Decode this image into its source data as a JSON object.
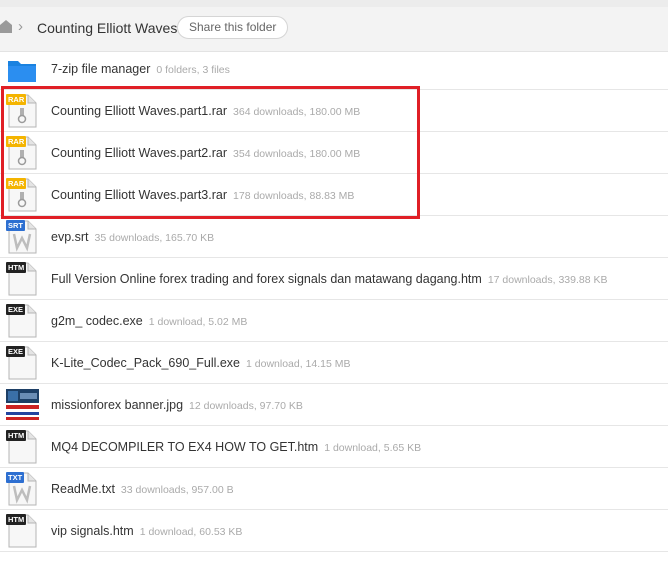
{
  "breadcrumb": {
    "separator": "›",
    "title": "Counting Elliott Waves"
  },
  "share_button": "Share this folder",
  "colors": {
    "highlight": "#e01f26",
    "folder": "#1a82e0",
    "rar_badge": "#f4b400",
    "srt_badge": "#2d6fd1",
    "txt_badge": "#2d6fd1",
    "dark_badge": "#222222"
  },
  "rows": [
    {
      "icon": "folder-icon",
      "name": "7-zip file manager",
      "meta": "0 folders, 3 files"
    },
    {
      "icon": "rar-file-icon",
      "badge": "RAR",
      "name": "Counting Elliott Waves.part1.rar",
      "meta": "364 downloads, 180.00 MB"
    },
    {
      "icon": "rar-file-icon",
      "badge": "RAR",
      "name": "Counting Elliott Waves.part2.rar",
      "meta": "354 downloads, 180.00 MB"
    },
    {
      "icon": "rar-file-icon",
      "badge": "RAR",
      "name": "Counting Elliott Waves.part3.rar",
      "meta": "178 downloads, 88.83 MB"
    },
    {
      "icon": "srt-file-icon",
      "badge": "SRT",
      "name": "evp.srt",
      "meta": "35 downloads, 165.70 KB"
    },
    {
      "icon": "htm-file-icon",
      "badge": "HTM",
      "name": "Full Version Online forex trading and forex signals dan matawang dagang.htm",
      "meta": "17 downloads, 339.88 KB"
    },
    {
      "icon": "exe-file-icon",
      "badge": "EXE",
      "name": "g2m_ codec.exe",
      "meta": "1 download, 5.02 MB"
    },
    {
      "icon": "exe-file-icon",
      "badge": "EXE",
      "name": "K-Lite_Codec_Pack_690_Full.exe",
      "meta": "1 download, 14.15 MB"
    },
    {
      "icon": "image-thumbnail",
      "name": "missionforex banner.jpg",
      "meta": "12 downloads, 97.70 KB"
    },
    {
      "icon": "htm-file-icon",
      "badge": "HTM",
      "name": "MQ4 DECOMPILER TO EX4 HOW TO GET.htm",
      "meta": "1 download, 5.65 KB"
    },
    {
      "icon": "txt-file-icon",
      "badge": "TXT",
      "name": "ReadMe.txt",
      "meta": "33 downloads, 957.00 B"
    },
    {
      "icon": "htm-file-icon",
      "badge": "HTM",
      "name": "vip signals.htm",
      "meta": "1 download, 60.53 KB"
    }
  ]
}
